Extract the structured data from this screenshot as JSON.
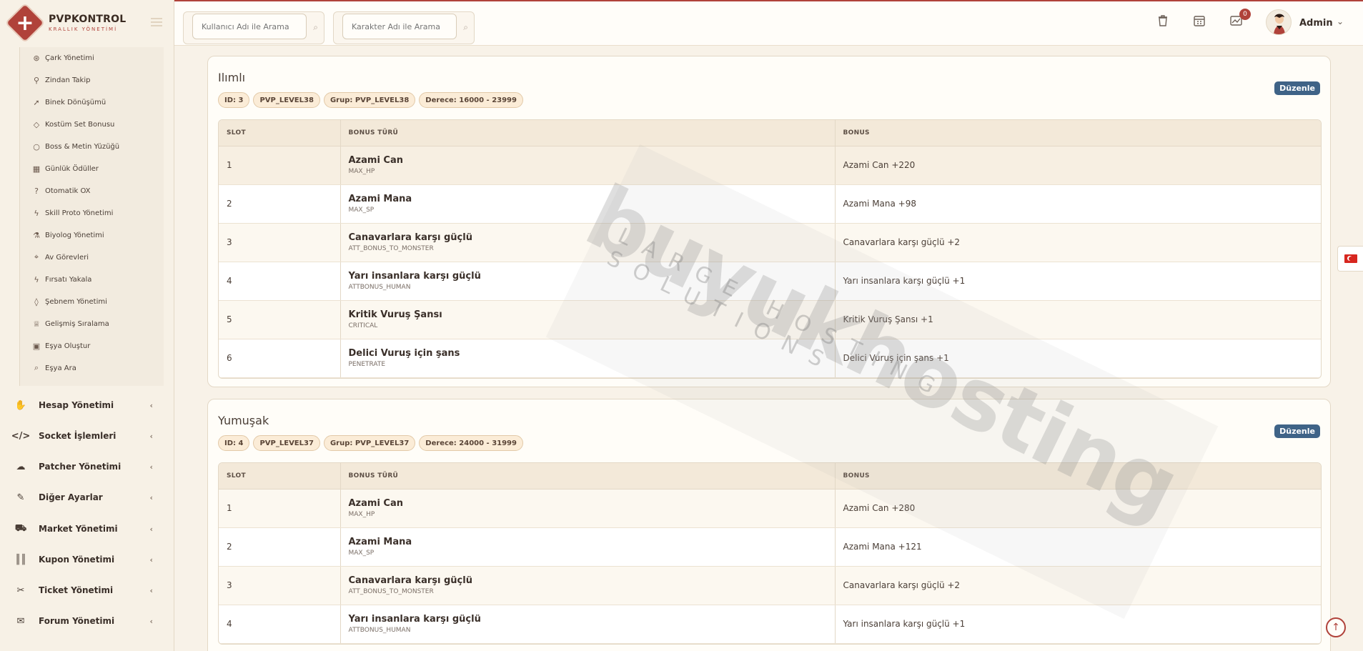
{
  "brand": {
    "title": "PVPKONTROL",
    "subtitle": "KRALLIK YÖNETİMİ"
  },
  "topbar": {
    "user_search_placeholder": "Kullanıcı Adı ile Arama",
    "char_search_placeholder": "Karakter Adı ile Arama",
    "notification_count": "0",
    "user_name": "Admin"
  },
  "submenu": [
    {
      "label": "Çark Yönetimi",
      "icon": "wheel-icon"
    },
    {
      "label": "Zindan Takip",
      "icon": "map-pin-icon"
    },
    {
      "label": "Binek Dönüşümü",
      "icon": "rocket-icon"
    },
    {
      "label": "Kostüm Set Bonusu",
      "icon": "gem-icon"
    },
    {
      "label": "Boss & Metin Yüzüğü",
      "icon": "ring-icon"
    },
    {
      "label": "Günlük Ödüller",
      "icon": "calendar-icon"
    },
    {
      "label": "Otomatik OX",
      "icon": "question-icon"
    },
    {
      "label": "Skill Proto Yönetimi",
      "icon": "bolt-icon"
    },
    {
      "label": "Biyolog Yönetimi",
      "icon": "flask-icon"
    },
    {
      "label": "Av Görevleri",
      "icon": "crosshair-icon"
    },
    {
      "label": "Fırsatı Yakala",
      "icon": "bolt-icon"
    },
    {
      "label": "Şebnem Yönetimi",
      "icon": "drop-icon"
    },
    {
      "label": "Gelişmiş Sıralama",
      "icon": "trophy-icon"
    },
    {
      "label": "Eşya Oluştur",
      "icon": "gift-icon"
    },
    {
      "label": "Eşya Ara",
      "icon": "search-icon"
    }
  ],
  "menu": [
    {
      "label": "Hesap Yönetimi",
      "icon": "paw-icon"
    },
    {
      "label": "Socket İşlemleri",
      "icon": "code-icon"
    },
    {
      "label": "Patcher Yönetimi",
      "icon": "cloud-upload-icon"
    },
    {
      "label": "Diğer Ayarlar",
      "icon": "wrench-icon"
    },
    {
      "label": "Market Yönetimi",
      "icon": "cart-icon"
    },
    {
      "label": "Kupon Yönetimi",
      "icon": "barcode-icon"
    },
    {
      "label": "Ticket Yönetimi",
      "icon": "ticket-icon"
    },
    {
      "label": "Forum Yönetimi",
      "icon": "comments-icon"
    }
  ],
  "table_headers": {
    "slot": "SLOT",
    "type": "BONUS TÜRÜ",
    "bonus": "BONUS"
  },
  "edit_label": "Düzenle",
  "cards": [
    {
      "title": "Ilımlı",
      "badges": [
        "ID: 3",
        "PVP_LEVEL38",
        "Grup: PVP_LEVEL38",
        "Derece: 16000 - 23999"
      ],
      "rows": [
        {
          "slot": "1",
          "name": "Azami Can",
          "code": "MAX_HP",
          "bonus": "Azami Can +220"
        },
        {
          "slot": "2",
          "name": "Azami Mana",
          "code": "MAX_SP",
          "bonus": "Azami Mana +98"
        },
        {
          "slot": "3",
          "name": "Canavarlara karşı güçlü",
          "code": "ATT_BONUS_TO_MONSTER",
          "bonus": "Canavarlara karşı güçlü +2"
        },
        {
          "slot": "4",
          "name": "Yarı insanlara karşı güçlü",
          "code": "ATTBONUS_HUMAN",
          "bonus": "Yarı insanlara karşı güçlü +1"
        },
        {
          "slot": "5",
          "name": "Kritik Vuruş Şansı",
          "code": "CRITICAL",
          "bonus": "Kritik Vuruş Şansı +1"
        },
        {
          "slot": "6",
          "name": "Delici Vuruş için şans",
          "code": "PENETRATE",
          "bonus": "Delici Vuruş için şans +1"
        }
      ]
    },
    {
      "title": "Yumuşak",
      "badges": [
        "ID: 4",
        "PVP_LEVEL37",
        "Grup: PVP_LEVEL37",
        "Derece: 24000 - 31999"
      ],
      "rows": [
        {
          "slot": "1",
          "name": "Azami Can",
          "code": "MAX_HP",
          "bonus": "Azami Can +280"
        },
        {
          "slot": "2",
          "name": "Azami Mana",
          "code": "MAX_SP",
          "bonus": "Azami Mana +121"
        },
        {
          "slot": "3",
          "name": "Canavarlara karşı güçlü",
          "code": "ATT_BONUS_TO_MONSTER",
          "bonus": "Canavarlara karşı güçlü +2"
        },
        {
          "slot": "4",
          "name": "Yarı insanlara karşı güçlü",
          "code": "ATTBONUS_HUMAN",
          "bonus": "Yarı insanlara karşı güçlü +1"
        }
      ]
    }
  ],
  "watermark": {
    "main": "buyukhosting",
    "sub": "LARGE HOSTING SOLUTIONS"
  },
  "colors": {
    "accent": "#b0423a",
    "edit_button": "#3f6387",
    "badge_bg": "#fbecd7"
  }
}
